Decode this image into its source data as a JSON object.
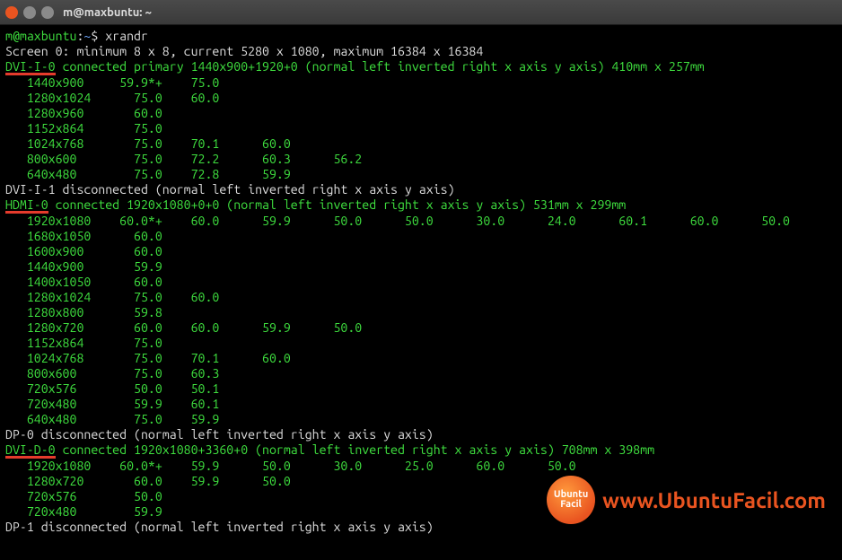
{
  "titlebar": {
    "title": "m@maxbuntu: ~"
  },
  "prompt": {
    "user": "m",
    "host": "maxbuntu",
    "path": "~",
    "sep1": "@",
    "sep2": ":",
    "sep3": "$"
  },
  "command": "xrandr",
  "lines": [
    {
      "t": "screen",
      "text": "Screen 0: minimum 8 x 8, current 5280 x 1080, maximum 16384 x 16384"
    },
    {
      "t": "conn",
      "name": "DVI-I-0",
      "rest": " connected primary 1440x900+1920+0 (normal left inverted right x axis y axis) 410mm x 257mm",
      "u": true
    },
    {
      "t": "mode",
      "res": "1440x900",
      "cols": [
        "59.9*+",
        "75.0"
      ]
    },
    {
      "t": "mode",
      "res": "1280x1024",
      "cols": [
        "75.0",
        "60.0"
      ]
    },
    {
      "t": "mode",
      "res": "1280x960",
      "cols": [
        "60.0"
      ]
    },
    {
      "t": "mode",
      "res": "1152x864",
      "cols": [
        "75.0"
      ]
    },
    {
      "t": "mode",
      "res": "1024x768",
      "cols": [
        "75.0",
        "70.1",
        "60.0"
      ]
    },
    {
      "t": "mode",
      "res": "800x600",
      "cols": [
        "75.0",
        "72.2",
        "60.3",
        "56.2"
      ]
    },
    {
      "t": "mode",
      "res": "640x480",
      "cols": [
        "75.0",
        "72.8",
        "59.9"
      ]
    },
    {
      "t": "disc",
      "text": "DVI-I-1 disconnected (normal left inverted right x axis y axis)"
    },
    {
      "t": "conn",
      "name": "HDMI-0",
      "rest": " connected 1920x1080+0+0 (normal left inverted right x axis y axis) 531mm x 299mm",
      "u": true
    },
    {
      "t": "mode",
      "res": "1920x1080",
      "cols": [
        "60.0*+",
        "60.0",
        "59.9",
        "50.0",
        "50.0",
        "30.0",
        "24.0",
        "60.1",
        "60.0",
        "50.0"
      ]
    },
    {
      "t": "mode",
      "res": "1680x1050",
      "cols": [
        "60.0"
      ]
    },
    {
      "t": "mode",
      "res": "1600x900",
      "cols": [
        "60.0"
      ]
    },
    {
      "t": "mode",
      "res": "1440x900",
      "cols": [
        "59.9"
      ]
    },
    {
      "t": "mode",
      "res": "1400x1050",
      "cols": [
        "60.0"
      ]
    },
    {
      "t": "mode",
      "res": "1280x1024",
      "cols": [
        "75.0",
        "60.0"
      ]
    },
    {
      "t": "mode",
      "res": "1280x800",
      "cols": [
        "59.8"
      ]
    },
    {
      "t": "mode",
      "res": "1280x720",
      "cols": [
        "60.0",
        "60.0",
        "59.9",
        "50.0"
      ]
    },
    {
      "t": "mode",
      "res": "1152x864",
      "cols": [
        "75.0"
      ]
    },
    {
      "t": "mode",
      "res": "1024x768",
      "cols": [
        "75.0",
        "70.1",
        "60.0"
      ]
    },
    {
      "t": "mode",
      "res": "800x600",
      "cols": [
        "75.0",
        "60.3"
      ]
    },
    {
      "t": "mode",
      "res": "720x576",
      "cols": [
        "50.0",
        "50.1"
      ]
    },
    {
      "t": "mode",
      "res": "720x480",
      "cols": [
        "59.9",
        "60.1"
      ]
    },
    {
      "t": "mode",
      "res": "640x480",
      "cols": [
        "75.0",
        "59.9"
      ]
    },
    {
      "t": "disc",
      "text": "DP-0 disconnected (normal left inverted right x axis y axis)"
    },
    {
      "t": "conn",
      "name": "DVI-D-0",
      "rest": " connected 1920x1080+3360+0 (normal left inverted right x axis y axis) 708mm x 398mm",
      "u": true
    },
    {
      "t": "mode",
      "res": "1920x1080",
      "cols": [
        "60.0*+",
        "59.9",
        "50.0",
        "30.0",
        "25.0",
        "60.0",
        "50.0"
      ]
    },
    {
      "t": "mode",
      "res": "1280x720",
      "cols": [
        "60.0",
        "59.9",
        "50.0"
      ]
    },
    {
      "t": "mode",
      "res": "720x576",
      "cols": [
        "50.0"
      ]
    },
    {
      "t": "mode",
      "res": "720x480",
      "cols": [
        "59.9"
      ]
    },
    {
      "t": "disc",
      "text": "DP-1 disconnected (normal left inverted right x axis y axis)"
    }
  ],
  "watermark": {
    "logo": "Ubuntu\nFacil",
    "text": "www.UbuntuFacil.com"
  }
}
